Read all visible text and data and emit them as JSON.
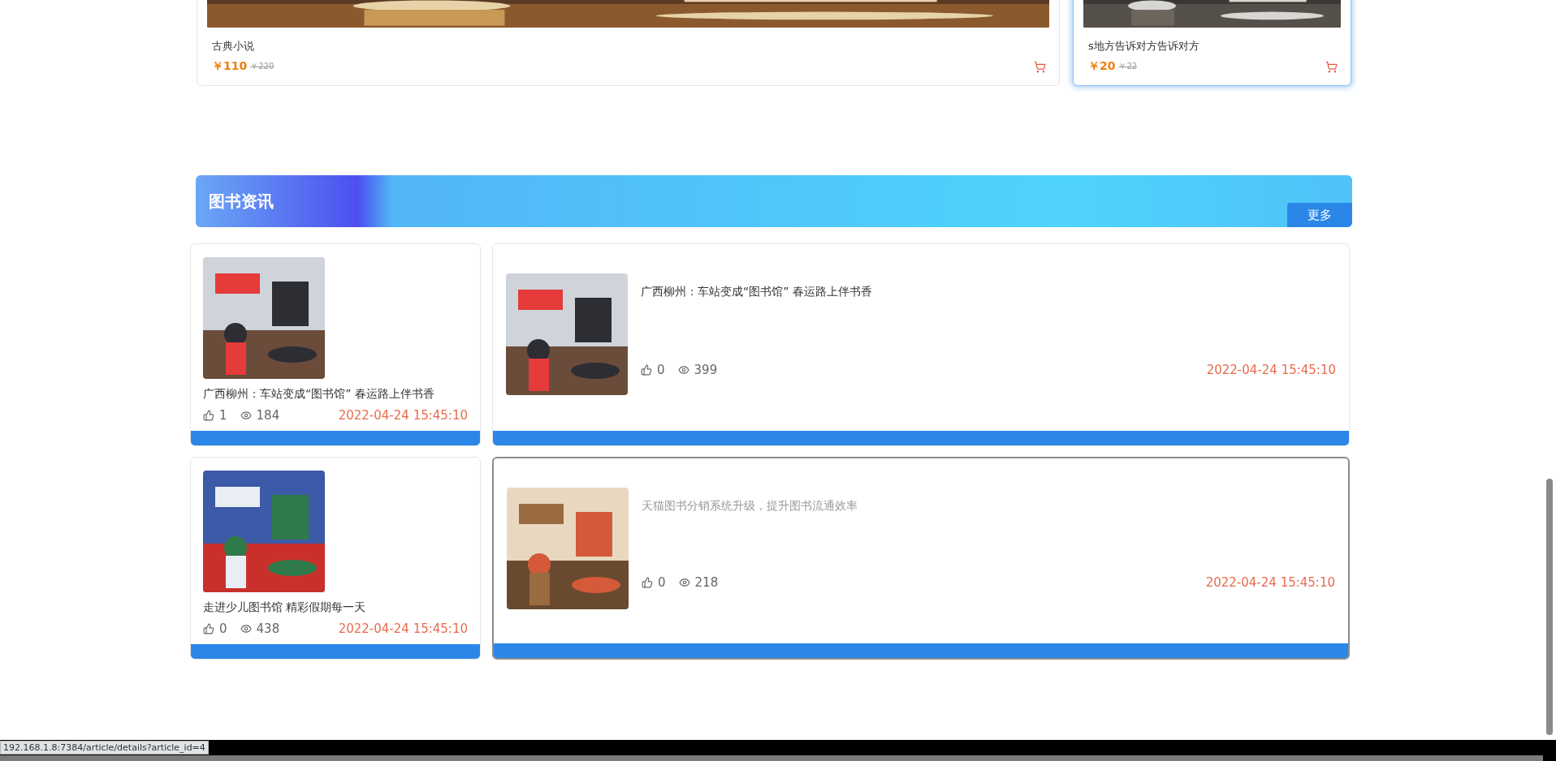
{
  "products": [
    {
      "title": "古典小说",
      "price": "￥110",
      "old_price": "￥220",
      "hovered": false
    },
    {
      "title": "s地方告诉对方告诉对方",
      "price": "￥20",
      "old_price": "￥22",
      "hovered": true
    }
  ],
  "news_section": {
    "title": "图书资讯",
    "more": "更多"
  },
  "news": [
    {
      "kind": "compact",
      "title": "广西柳州：车站变成“图书馆” 春运路上伴书香",
      "likes": "1",
      "views": "184",
      "date": "2022-04-24 15:45:10",
      "hovered": false
    },
    {
      "kind": "wide",
      "title": "广西柳州：车站变成“图书馆” 春运路上伴书香",
      "likes": "0",
      "views": "399",
      "date": "2022-04-24 15:45:10",
      "hovered": false
    },
    {
      "kind": "compact",
      "title": "走进少儿图书馆 精彩假期每一天",
      "likes": "0",
      "views": "438",
      "date": "2022-04-24 15:45:10",
      "hovered": false
    },
    {
      "kind": "wide",
      "title": "天猫图书分销系统升级，提升图书流通效率",
      "likes": "0",
      "views": "218",
      "date": "2022-04-24 15:45:10",
      "hovered": true
    }
  ],
  "status_bar": {
    "url": "192.168.1.8:7384/article/details?article_id=4"
  }
}
